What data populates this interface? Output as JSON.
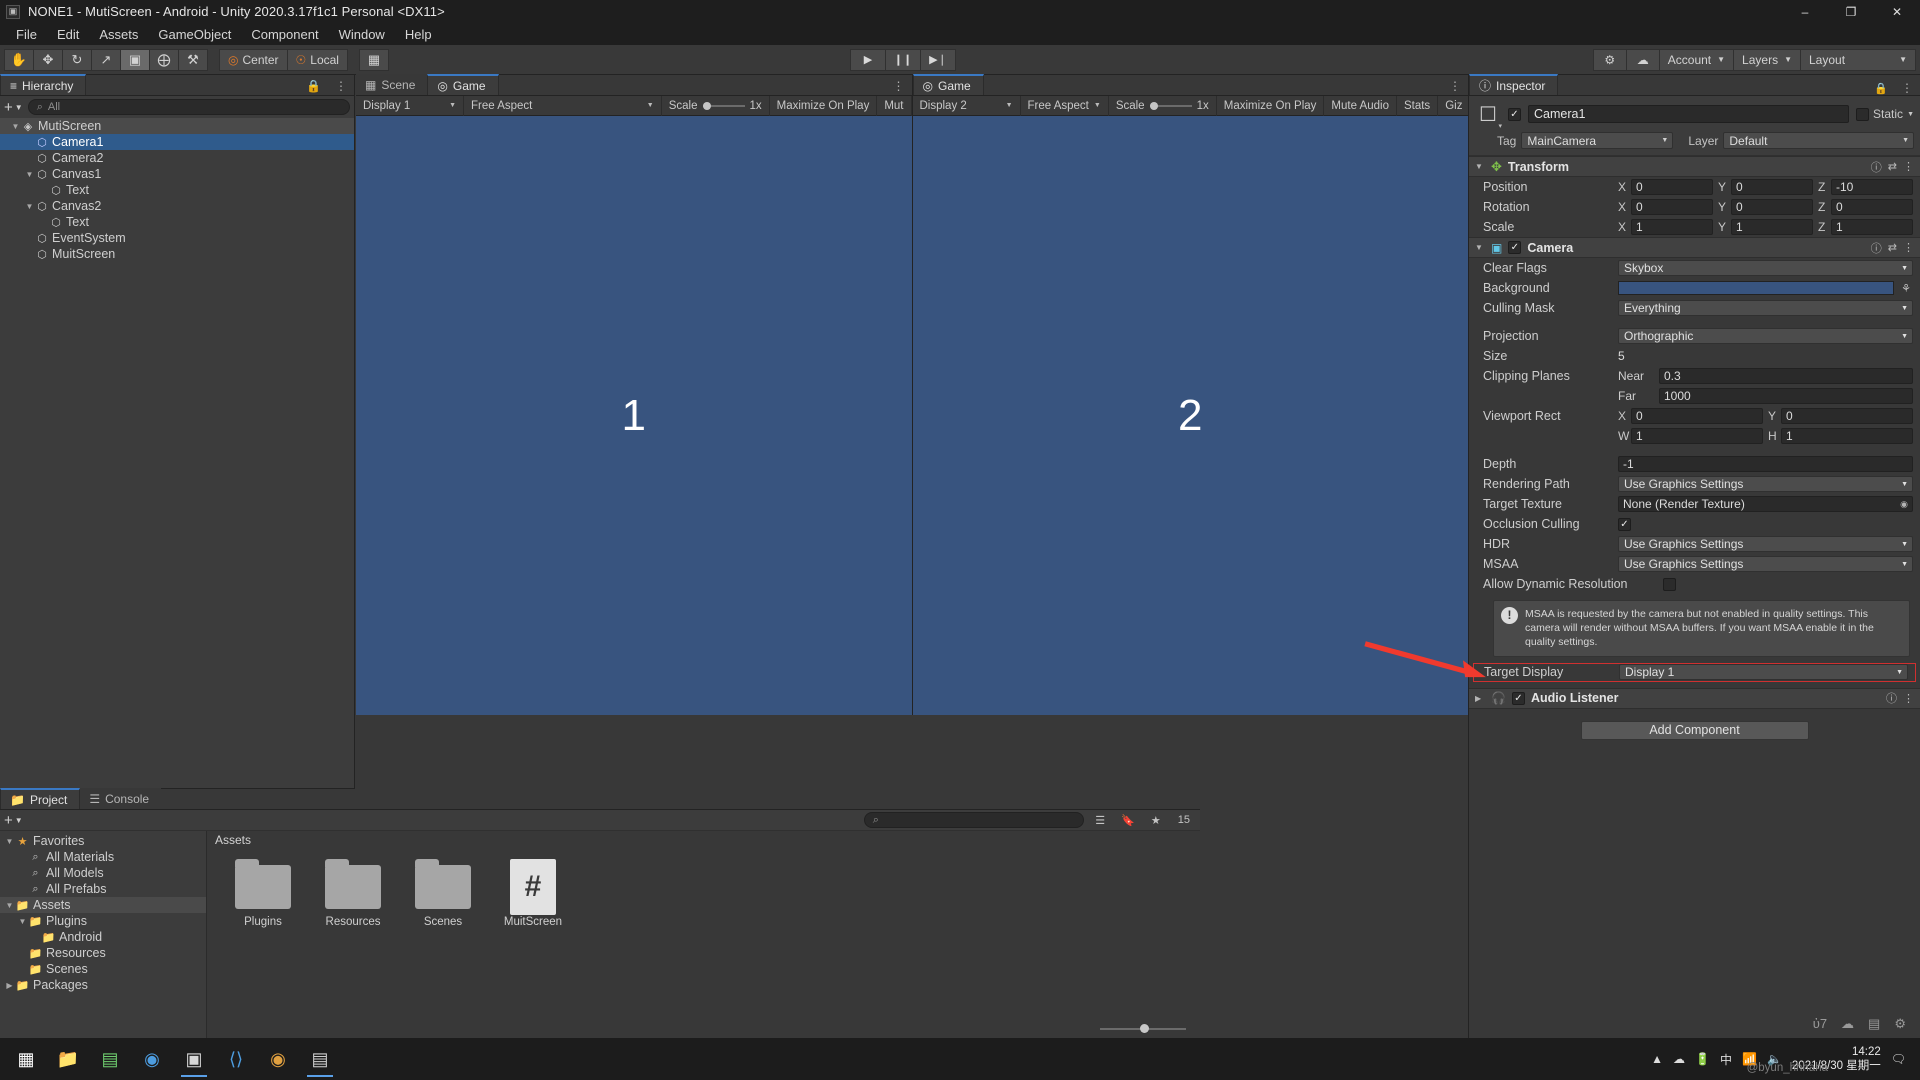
{
  "window": {
    "title": "NONE1 - MutiScreen - Android - Unity 2020.3.17f1c1 Personal <DX11>",
    "app_icon": "unity-icon",
    "minimize": "–",
    "maximize": "❐",
    "close": "✕"
  },
  "menubar": {
    "items": [
      "File",
      "Edit",
      "Assets",
      "GameObject",
      "Component",
      "Window",
      "Help"
    ]
  },
  "toolbar": {
    "tools": [
      {
        "name": "hand-tool",
        "glyph": "✋",
        "selected": false
      },
      {
        "name": "move-tool",
        "glyph": "✥",
        "selected": false
      },
      {
        "name": "rotate-tool",
        "glyph": "↻",
        "selected": false
      },
      {
        "name": "scale-tool",
        "glyph": "↗",
        "selected": false
      },
      {
        "name": "rect-tool",
        "glyph": "▣",
        "selected": true
      },
      {
        "name": "transform-tool",
        "glyph": "⨁",
        "selected": false
      },
      {
        "name": "custom-tool",
        "glyph": "⚒",
        "selected": false
      }
    ],
    "pivot_label": "Center",
    "space_label": "Local",
    "grid_label": "▦",
    "play": "▶",
    "pause": "❙❙",
    "step": "▶❘",
    "cloud_icon": "☁",
    "services_icon": "⚙",
    "account_label": "Account",
    "layers_label": "Layers",
    "layout_label": "Layout"
  },
  "hierarchy": {
    "tab_label": "Hierarchy",
    "tab_icon": "hierarchy-icon",
    "search_placeholder": "All",
    "add_label": "+",
    "items": [
      {
        "label": "MutiScreen",
        "depth": 0,
        "expanded": true,
        "selected": false,
        "is_scene": true
      },
      {
        "label": "Camera1",
        "depth": 1,
        "expanded": false,
        "selected": true,
        "is_scene": false
      },
      {
        "label": "Camera2",
        "depth": 1,
        "expanded": false,
        "selected": false,
        "is_scene": false
      },
      {
        "label": "Canvas1",
        "depth": 1,
        "expanded": true,
        "selected": false,
        "is_scene": false
      },
      {
        "label": "Text",
        "depth": 2,
        "expanded": false,
        "selected": false,
        "is_scene": false
      },
      {
        "label": "Canvas2",
        "depth": 1,
        "expanded": true,
        "selected": false,
        "is_scene": false
      },
      {
        "label": "Text",
        "depth": 2,
        "expanded": false,
        "selected": false,
        "is_scene": false
      },
      {
        "label": "EventSystem",
        "depth": 1,
        "expanded": false,
        "selected": false,
        "is_scene": false
      },
      {
        "label": "MuitScreen",
        "depth": 1,
        "expanded": false,
        "selected": false,
        "is_scene": false
      }
    ]
  },
  "scene_view": {
    "tab_scene": "Scene",
    "tab_game": "Game",
    "display": "Display 1",
    "aspect": "Free Aspect",
    "scale_label": "Scale",
    "scale_value": "1x",
    "maximize_label": "Maximize On Play",
    "mute_label": "Mut",
    "content_number": "1",
    "background_color": "#38547f"
  },
  "game_view": {
    "tab_game": "Game",
    "display": "Display 2",
    "aspect": "Free Aspect",
    "scale_label": "Scale",
    "scale_value": "1x",
    "maximize_label": "Maximize On Play",
    "mute_label": "Mute Audio",
    "stats_label": "Stats",
    "gizmos_label": "Giz",
    "content_number": "2",
    "background_color": "#38547f"
  },
  "project": {
    "tab_project": "Project",
    "tab_console": "Console",
    "search_placeholder": "",
    "counter": "15",
    "breadcrumb": "Assets",
    "tree": [
      {
        "label": "Favorites",
        "depth": 0,
        "icon": "star-icon",
        "tri": "▼",
        "selected": false
      },
      {
        "label": "All Materials",
        "depth": 1,
        "icon": "search-icon",
        "tri": "",
        "selected": false
      },
      {
        "label": "All Models",
        "depth": 1,
        "icon": "search-icon",
        "tri": "",
        "selected": false
      },
      {
        "label": "All Prefabs",
        "depth": 1,
        "icon": "search-icon",
        "tri": "",
        "selected": false
      },
      {
        "label": "Assets",
        "depth": 0,
        "icon": "folder-icon",
        "tri": "▼",
        "selected": true
      },
      {
        "label": "Plugins",
        "depth": 1,
        "icon": "folder-icon",
        "tri": "▼",
        "selected": false
      },
      {
        "label": "Android",
        "depth": 2,
        "icon": "folder-icon",
        "tri": "",
        "selected": false
      },
      {
        "label": "Resources",
        "depth": 1,
        "icon": "folder-icon",
        "tri": "",
        "selected": false
      },
      {
        "label": "Scenes",
        "depth": 1,
        "icon": "folder-icon",
        "tri": "",
        "selected": false
      },
      {
        "label": "Packages",
        "depth": 0,
        "icon": "folder-icon",
        "tri": "▶",
        "selected": false
      }
    ],
    "assets": [
      {
        "name": "Plugins",
        "type": "folder"
      },
      {
        "name": "Resources",
        "type": "folder"
      },
      {
        "name": "Scenes",
        "type": "folder"
      },
      {
        "name": "MuitScreen",
        "type": "script",
        "glyph": "#"
      }
    ]
  },
  "inspector": {
    "tab_label": "Inspector",
    "object_name": "Camera1",
    "enabled": true,
    "static_label": "Static",
    "tag_label": "Tag",
    "tag_value": "MainCamera",
    "layer_label": "Layer",
    "layer_value": "Default",
    "transform": {
      "title": "Transform",
      "rows": [
        {
          "name": "Position",
          "x": "0",
          "y": "0",
          "z": "-10"
        },
        {
          "name": "Rotation",
          "x": "0",
          "y": "0",
          "z": "0"
        },
        {
          "name": "Scale",
          "x": "1",
          "y": "1",
          "z": "1"
        }
      ]
    },
    "camera": {
      "title": "Camera",
      "enabled": true,
      "clear_flags_label": "Clear Flags",
      "clear_flags_value": "Skybox",
      "background_label": "Background",
      "background_color": "#38547f",
      "culling_mask_label": "Culling Mask",
      "culling_mask_value": "Everything",
      "projection_label": "Projection",
      "projection_value": "Orthographic",
      "size_label": "Size",
      "size_value": "5",
      "clipping_label": "Clipping Planes",
      "near_label": "Near",
      "near_value": "0.3",
      "far_label": "Far",
      "far_value": "1000",
      "viewport_label": "Viewport Rect",
      "viewport_x_label": "X",
      "viewport_x": "0",
      "viewport_y_label": "Y",
      "viewport_y": "0",
      "viewport_w_label": "W",
      "viewport_w": "1",
      "viewport_h_label": "H",
      "viewport_h": "1",
      "depth_label": "Depth",
      "depth_value": "-1",
      "rendering_path_label": "Rendering Path",
      "rendering_path_value": "Use Graphics Settings",
      "target_texture_label": "Target Texture",
      "target_texture_value": "None (Render Texture)",
      "occlusion_label": "Occlusion Culling",
      "occlusion_checked": true,
      "hdr_label": "HDR",
      "hdr_value": "Use Graphics Settings",
      "msaa_label": "MSAA",
      "msaa_value": "Use Graphics Settings",
      "allow_dynres_label": "Allow Dynamic Resolution",
      "allow_dynres_checked": false,
      "warning_text": "MSAA is requested by the camera but not enabled in quality settings. This camera will render without MSAA buffers. If you want MSAA enable it in the quality settings.",
      "target_display_label": "Target Display",
      "target_display_value": "Display 1"
    },
    "audio_listener": {
      "title": "Audio Listener",
      "enabled": true
    },
    "add_component_label": "Add Component"
  },
  "annotation": {
    "arrow_color": "#f03a2e",
    "points_to": "Target Display"
  },
  "taskbar": {
    "icons": [
      {
        "name": "start-icon",
        "glyph": "⊞"
      },
      {
        "name": "file-explorer-icon",
        "glyph": "Ὄ1"
      },
      {
        "name": "store-icon",
        "glyph": "⌸"
      },
      {
        "name": "chrome-icon",
        "glyph": "◉"
      },
      {
        "name": "unity-icon",
        "glyph": "◰",
        "active": true
      },
      {
        "name": "vscode-icon",
        "glyph": "⬡"
      },
      {
        "name": "app-icon",
        "glyph": "◑"
      },
      {
        "name": "unity-hub-icon",
        "glyph": "◱",
        "active": true
      }
    ],
    "tray": {
      "chevron": "⌃",
      "battery": "▮",
      "network": "὚7",
      "ime": "中",
      "volume": "ὐA",
      "cloud": "☁"
    },
    "time": "14:22",
    "date": "2021/8/30 星期一",
    "notification": "▣"
  },
  "statusbar": {
    "icons": [
      "ὐ7",
      "☁",
      "▤",
      "⚙"
    ],
    "watermark": "@byun_hhhaha"
  }
}
